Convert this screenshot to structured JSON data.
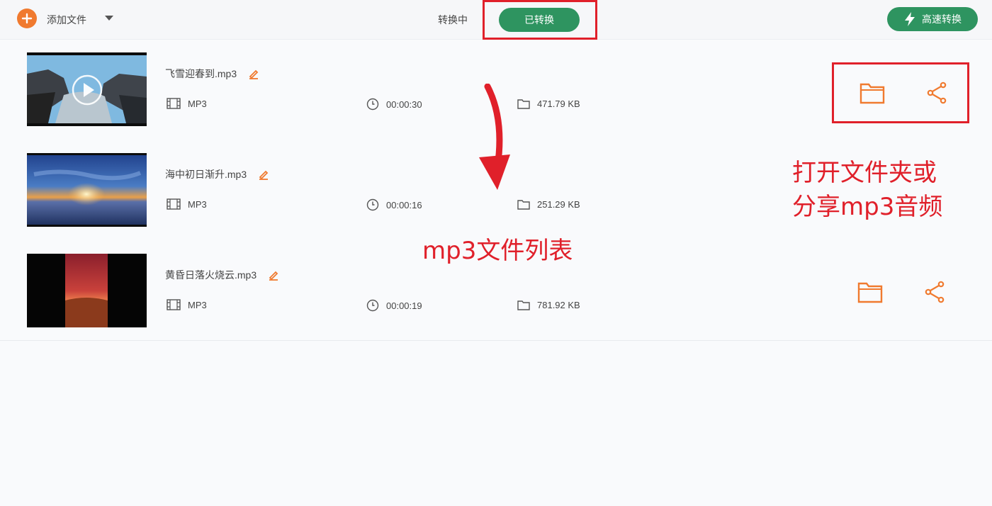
{
  "toolbar": {
    "add_label": "添加文件",
    "tab_converting": "转换中",
    "tab_converted": "已转换",
    "turbo_label": "高速转换"
  },
  "colors": {
    "accent_orange": "#f07a2f",
    "brand_green": "#2e9460",
    "annotation_red": "#e0202a"
  },
  "files": [
    {
      "name": "飞雪迎春到.mp3",
      "format": "MP3",
      "duration": "00:00:30",
      "size": "471.79 KB"
    },
    {
      "name": "海中初日渐升.mp3",
      "format": "MP3",
      "duration": "00:00:16",
      "size": "251.29 KB"
    },
    {
      "name": "黄昏日落火烧云.mp3",
      "format": "MP3",
      "duration": "00:00:19",
      "size": "781.92 KB"
    }
  ],
  "annotations": {
    "list_note": "mp3文件列表",
    "actions_note_line1": "打开文件夹或",
    "actions_note_line2": "分享mp3音频"
  },
  "icons": [
    "plus-icon",
    "chevron-down-icon",
    "lightning-icon",
    "edit-icon",
    "film-icon",
    "clock-icon",
    "folder-icon",
    "share-icon",
    "play-icon"
  ]
}
